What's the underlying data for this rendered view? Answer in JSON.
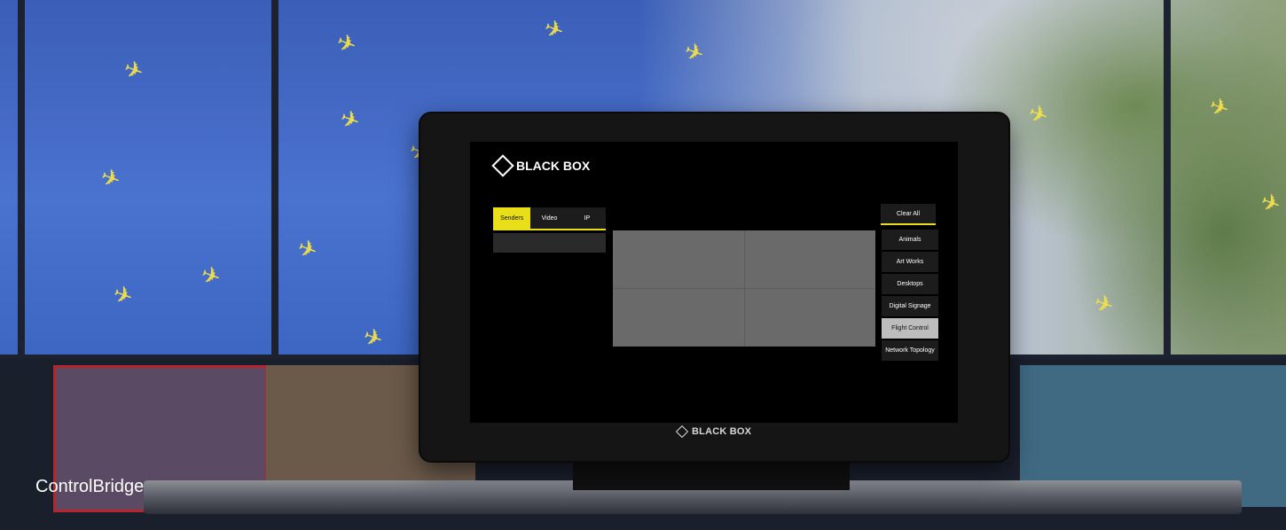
{
  "app": {
    "brand": "BLACK BOX",
    "tabs": [
      {
        "label": "Senders",
        "active": true
      },
      {
        "label": "Video",
        "active": false
      },
      {
        "label": "IP",
        "active": false
      }
    ],
    "clear_all_label": "Clear All",
    "presets": [
      {
        "label": "Animals",
        "selected": false
      },
      {
        "label": "Art Works",
        "selected": false
      },
      {
        "label": "Desktops",
        "selected": false
      },
      {
        "label": "Digital Signage",
        "selected": false
      },
      {
        "label": "Flight Control",
        "selected": true
      },
      {
        "label": "Network Topology",
        "selected": false
      }
    ],
    "video_wall_cells": 4
  },
  "device": {
    "bezel_brand": "BLACK BOX"
  },
  "caption": "ControlBridge",
  "colors": {
    "accent": "#e8df1a",
    "screen_background": "#000000",
    "wall_cell": "#6a6a6a",
    "selected_preset": "#bdbdbd"
  }
}
